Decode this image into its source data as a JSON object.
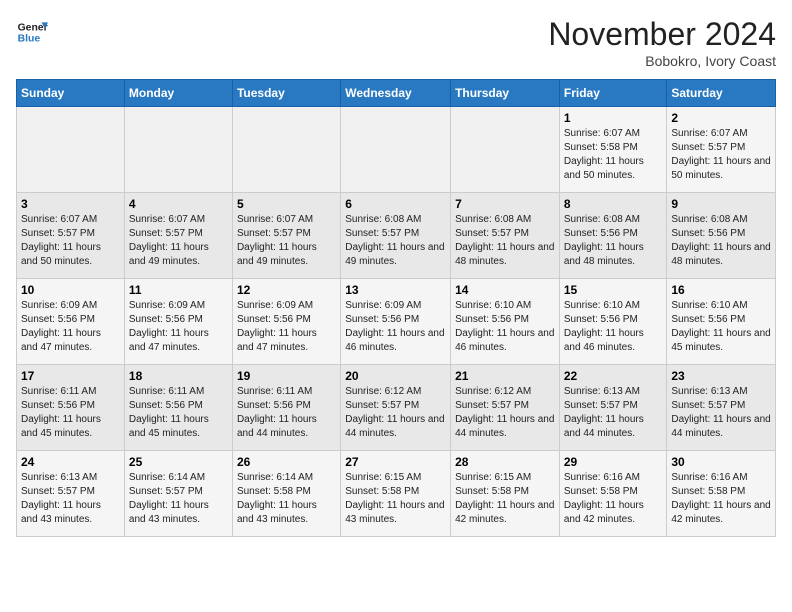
{
  "header": {
    "logo_line1": "General",
    "logo_line2": "Blue",
    "month": "November 2024",
    "location": "Bobokro, Ivory Coast"
  },
  "days_of_week": [
    "Sunday",
    "Monday",
    "Tuesday",
    "Wednesday",
    "Thursday",
    "Friday",
    "Saturday"
  ],
  "weeks": [
    [
      {
        "day": "",
        "info": ""
      },
      {
        "day": "",
        "info": ""
      },
      {
        "day": "",
        "info": ""
      },
      {
        "day": "",
        "info": ""
      },
      {
        "day": "",
        "info": ""
      },
      {
        "day": "1",
        "info": "Sunrise: 6:07 AM\nSunset: 5:58 PM\nDaylight: 11 hours and 50 minutes."
      },
      {
        "day": "2",
        "info": "Sunrise: 6:07 AM\nSunset: 5:57 PM\nDaylight: 11 hours and 50 minutes."
      }
    ],
    [
      {
        "day": "3",
        "info": "Sunrise: 6:07 AM\nSunset: 5:57 PM\nDaylight: 11 hours and 50 minutes."
      },
      {
        "day": "4",
        "info": "Sunrise: 6:07 AM\nSunset: 5:57 PM\nDaylight: 11 hours and 49 minutes."
      },
      {
        "day": "5",
        "info": "Sunrise: 6:07 AM\nSunset: 5:57 PM\nDaylight: 11 hours and 49 minutes."
      },
      {
        "day": "6",
        "info": "Sunrise: 6:08 AM\nSunset: 5:57 PM\nDaylight: 11 hours and 49 minutes."
      },
      {
        "day": "7",
        "info": "Sunrise: 6:08 AM\nSunset: 5:57 PM\nDaylight: 11 hours and 48 minutes."
      },
      {
        "day": "8",
        "info": "Sunrise: 6:08 AM\nSunset: 5:56 PM\nDaylight: 11 hours and 48 minutes."
      },
      {
        "day": "9",
        "info": "Sunrise: 6:08 AM\nSunset: 5:56 PM\nDaylight: 11 hours and 48 minutes."
      }
    ],
    [
      {
        "day": "10",
        "info": "Sunrise: 6:09 AM\nSunset: 5:56 PM\nDaylight: 11 hours and 47 minutes."
      },
      {
        "day": "11",
        "info": "Sunrise: 6:09 AM\nSunset: 5:56 PM\nDaylight: 11 hours and 47 minutes."
      },
      {
        "day": "12",
        "info": "Sunrise: 6:09 AM\nSunset: 5:56 PM\nDaylight: 11 hours and 47 minutes."
      },
      {
        "day": "13",
        "info": "Sunrise: 6:09 AM\nSunset: 5:56 PM\nDaylight: 11 hours and 46 minutes."
      },
      {
        "day": "14",
        "info": "Sunrise: 6:10 AM\nSunset: 5:56 PM\nDaylight: 11 hours and 46 minutes."
      },
      {
        "day": "15",
        "info": "Sunrise: 6:10 AM\nSunset: 5:56 PM\nDaylight: 11 hours and 46 minutes."
      },
      {
        "day": "16",
        "info": "Sunrise: 6:10 AM\nSunset: 5:56 PM\nDaylight: 11 hours and 45 minutes."
      }
    ],
    [
      {
        "day": "17",
        "info": "Sunrise: 6:11 AM\nSunset: 5:56 PM\nDaylight: 11 hours and 45 minutes."
      },
      {
        "day": "18",
        "info": "Sunrise: 6:11 AM\nSunset: 5:56 PM\nDaylight: 11 hours and 45 minutes."
      },
      {
        "day": "19",
        "info": "Sunrise: 6:11 AM\nSunset: 5:56 PM\nDaylight: 11 hours and 44 minutes."
      },
      {
        "day": "20",
        "info": "Sunrise: 6:12 AM\nSunset: 5:57 PM\nDaylight: 11 hours and 44 minutes."
      },
      {
        "day": "21",
        "info": "Sunrise: 6:12 AM\nSunset: 5:57 PM\nDaylight: 11 hours and 44 minutes."
      },
      {
        "day": "22",
        "info": "Sunrise: 6:13 AM\nSunset: 5:57 PM\nDaylight: 11 hours and 44 minutes."
      },
      {
        "day": "23",
        "info": "Sunrise: 6:13 AM\nSunset: 5:57 PM\nDaylight: 11 hours and 44 minutes."
      }
    ],
    [
      {
        "day": "24",
        "info": "Sunrise: 6:13 AM\nSunset: 5:57 PM\nDaylight: 11 hours and 43 minutes."
      },
      {
        "day": "25",
        "info": "Sunrise: 6:14 AM\nSunset: 5:57 PM\nDaylight: 11 hours and 43 minutes."
      },
      {
        "day": "26",
        "info": "Sunrise: 6:14 AM\nSunset: 5:58 PM\nDaylight: 11 hours and 43 minutes."
      },
      {
        "day": "27",
        "info": "Sunrise: 6:15 AM\nSunset: 5:58 PM\nDaylight: 11 hours and 43 minutes."
      },
      {
        "day": "28",
        "info": "Sunrise: 6:15 AM\nSunset: 5:58 PM\nDaylight: 11 hours and 42 minutes."
      },
      {
        "day": "29",
        "info": "Sunrise: 6:16 AM\nSunset: 5:58 PM\nDaylight: 11 hours and 42 minutes."
      },
      {
        "day": "30",
        "info": "Sunrise: 6:16 AM\nSunset: 5:58 PM\nDaylight: 11 hours and 42 minutes."
      }
    ]
  ]
}
